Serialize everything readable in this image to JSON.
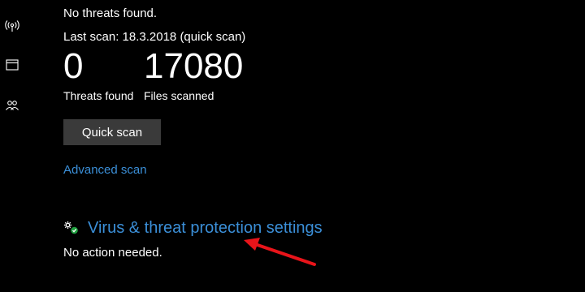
{
  "sidebar": {
    "icons": [
      "wireless-icon",
      "browser-window-icon",
      "family-icon"
    ]
  },
  "status": {
    "text": "No threats found."
  },
  "last_scan": {
    "text": "Last scan: 18.3.2018 (quick scan)"
  },
  "stats": {
    "threats": {
      "value": "0",
      "label": "Threats found"
    },
    "files": {
      "value": "17080",
      "label": "Files scanned"
    }
  },
  "actions": {
    "quick_scan_label": "Quick scan",
    "advanced_scan_label": "Advanced scan"
  },
  "settings": {
    "title": "Virus & threat protection settings",
    "status": "No action needed.",
    "icon": "gear-settings-icon"
  },
  "colors": {
    "background": "#000000",
    "link": "#3b8fd8",
    "button": "#3a3a3a",
    "annotation_arrow": "#e8141a"
  }
}
